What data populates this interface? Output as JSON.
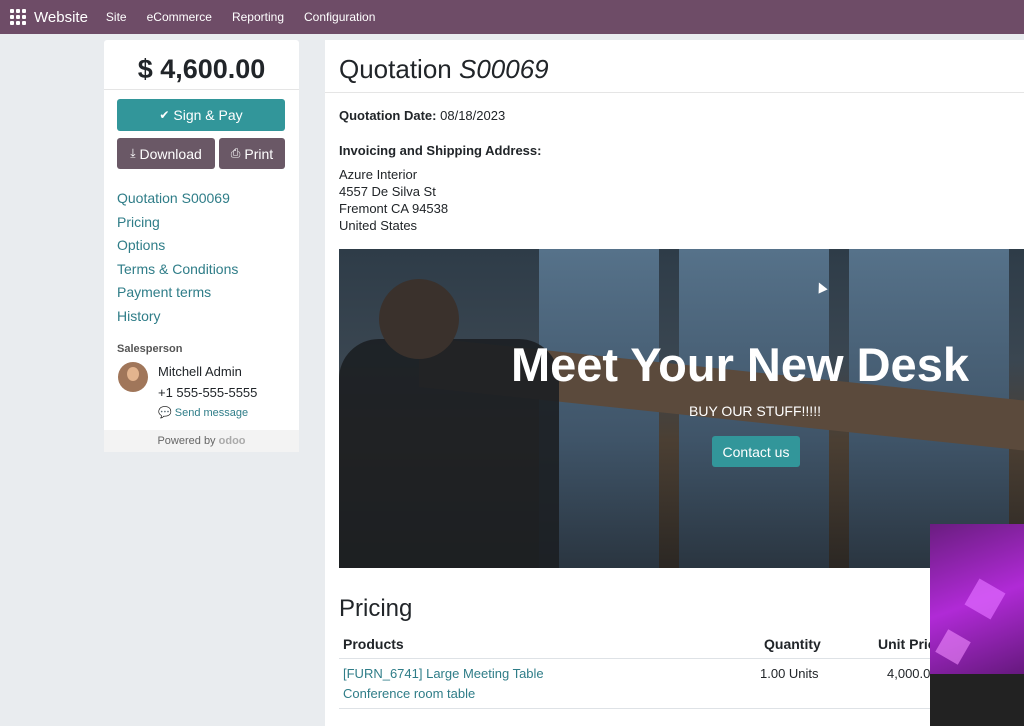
{
  "topbar": {
    "brand": "Website",
    "menu": [
      "Site",
      "eCommerce",
      "Reporting",
      "Configuration"
    ]
  },
  "sidebar": {
    "total": "$ 4,600.00",
    "sign_pay_label": "Sign & Pay",
    "download_label": "Download",
    "print_label": "Print",
    "nav": [
      "Quotation S00069",
      "Pricing",
      "Options",
      "Terms & Conditions",
      "Payment terms",
      "History"
    ],
    "salesperson_title": "Salesperson",
    "salesperson_name": "Mitchell Admin",
    "salesperson_phone": "+1 555-555-5555",
    "send_message_label": "Send message",
    "powered_by": "Powered by",
    "powered_brand": "odoo"
  },
  "main": {
    "title_prefix": "Quotation",
    "title_number": "S00069",
    "quotation_date_label": "Quotation Date:",
    "quotation_date": "08/18/2023",
    "address_label": "Invoicing and Shipping Address:",
    "address_lines": [
      "Azure Interior",
      "4557 De Silva St",
      "Fremont CA 94538",
      "United States"
    ],
    "banner": {
      "heading": "Meet Your New Desk",
      "subheading": "BUY OUR STUFF!!!!!",
      "cta_label": "Contact us"
    },
    "pricing": {
      "title": "Pricing",
      "headers": [
        "Products",
        "Quantity",
        "Unit Pric"
      ],
      "rows": [
        {
          "product_line1": "[FURN_6741] Large Meeting Table",
          "product_line2": "Conference room table",
          "quantity": "1.00 Units",
          "unit_price": "4,000.0"
        }
      ]
    }
  },
  "colors": {
    "navbar": "#6e4c67",
    "primary": "#32969a",
    "secondary_button": "#6a5866",
    "link": "#2f7d88"
  }
}
